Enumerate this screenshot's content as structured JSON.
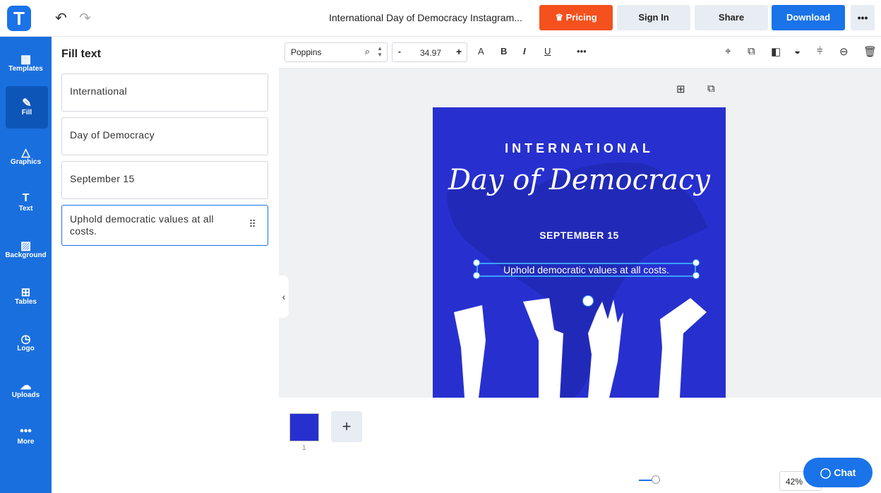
{
  "header": {
    "logo": "T",
    "undo_icon": "↶",
    "redo_icon": "↷",
    "title": "International Day of Democracy Instagram...",
    "pricing": "Pricing",
    "sign_in": "Sign In",
    "share": "Share",
    "download": "Download",
    "more": "•••"
  },
  "sidebar": {
    "items": [
      {
        "icon": "▦",
        "label": "Templates"
      },
      {
        "icon": "✎",
        "label": "Fill"
      },
      {
        "icon": "△",
        "label": "Graphics"
      },
      {
        "icon": "T",
        "label": "Text"
      },
      {
        "icon": "▨",
        "label": "Background"
      },
      {
        "icon": "⊞",
        "label": "Tables"
      },
      {
        "icon": "◷",
        "label": "Logo"
      },
      {
        "icon": "☁",
        "label": "Uploads"
      },
      {
        "icon": "•••",
        "label": "More"
      }
    ]
  },
  "panel": {
    "title": "Fill text",
    "fields": [
      "International",
      "Day of Democracy",
      "September 15",
      "Uphold democratic values at all costs."
    ]
  },
  "toolbar": {
    "font": "Poppins",
    "font_size": "34.97",
    "minus": "-",
    "plus": "+"
  },
  "design": {
    "line1": "INTERNATIONAL",
    "line2": "Day of Democracy",
    "line3": "SEPTEMBER 15",
    "line4": "Uphold democratic values at all costs."
  },
  "pages": {
    "add": "+",
    "page_number": "1"
  },
  "zoom": {
    "value": "42%"
  },
  "chat": {
    "label": "Chat"
  },
  "colors": {
    "accent": "#1a73e8",
    "pricing": "#f4511e",
    "design_bg": "#2730cf"
  }
}
